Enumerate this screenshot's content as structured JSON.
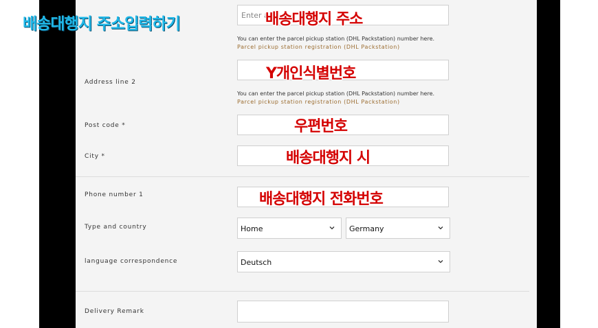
{
  "overlay_title": "배송대행지 주소입력하기",
  "address1": {
    "placeholder": "Enter a",
    "placeholder_tail": "e",
    "annotation": "배송대행지 주소",
    "hint": "You can enter the parcel pickup station (DHL Packstation) number here.",
    "link": "Parcel pickup station registration (DHL Packstation)"
  },
  "address2": {
    "label": "Address line 2",
    "annotation": "Y개인식별번호",
    "hint": "You can enter the parcel pickup station (DHL Packstation) number here.",
    "link": "Parcel pickup station registration (DHL Packstation)"
  },
  "postcode": {
    "label": "Post code *",
    "annotation": "우편번호"
  },
  "city": {
    "label": "City *",
    "annotation": "배송대행지 시"
  },
  "phone": {
    "label": "Phone number 1",
    "annotation": "배송대행지 전화번호"
  },
  "type_country": {
    "label": "Type and country",
    "type_value": "Home",
    "country_value": "Germany"
  },
  "language": {
    "label": "language correspondence",
    "value": "Deutsch"
  },
  "remark": {
    "label": "Delivery Remark"
  },
  "colors": {
    "annotation_red": "#d40000",
    "title_blue": "#20b8e8",
    "link_brown": "#9a6b2e"
  }
}
